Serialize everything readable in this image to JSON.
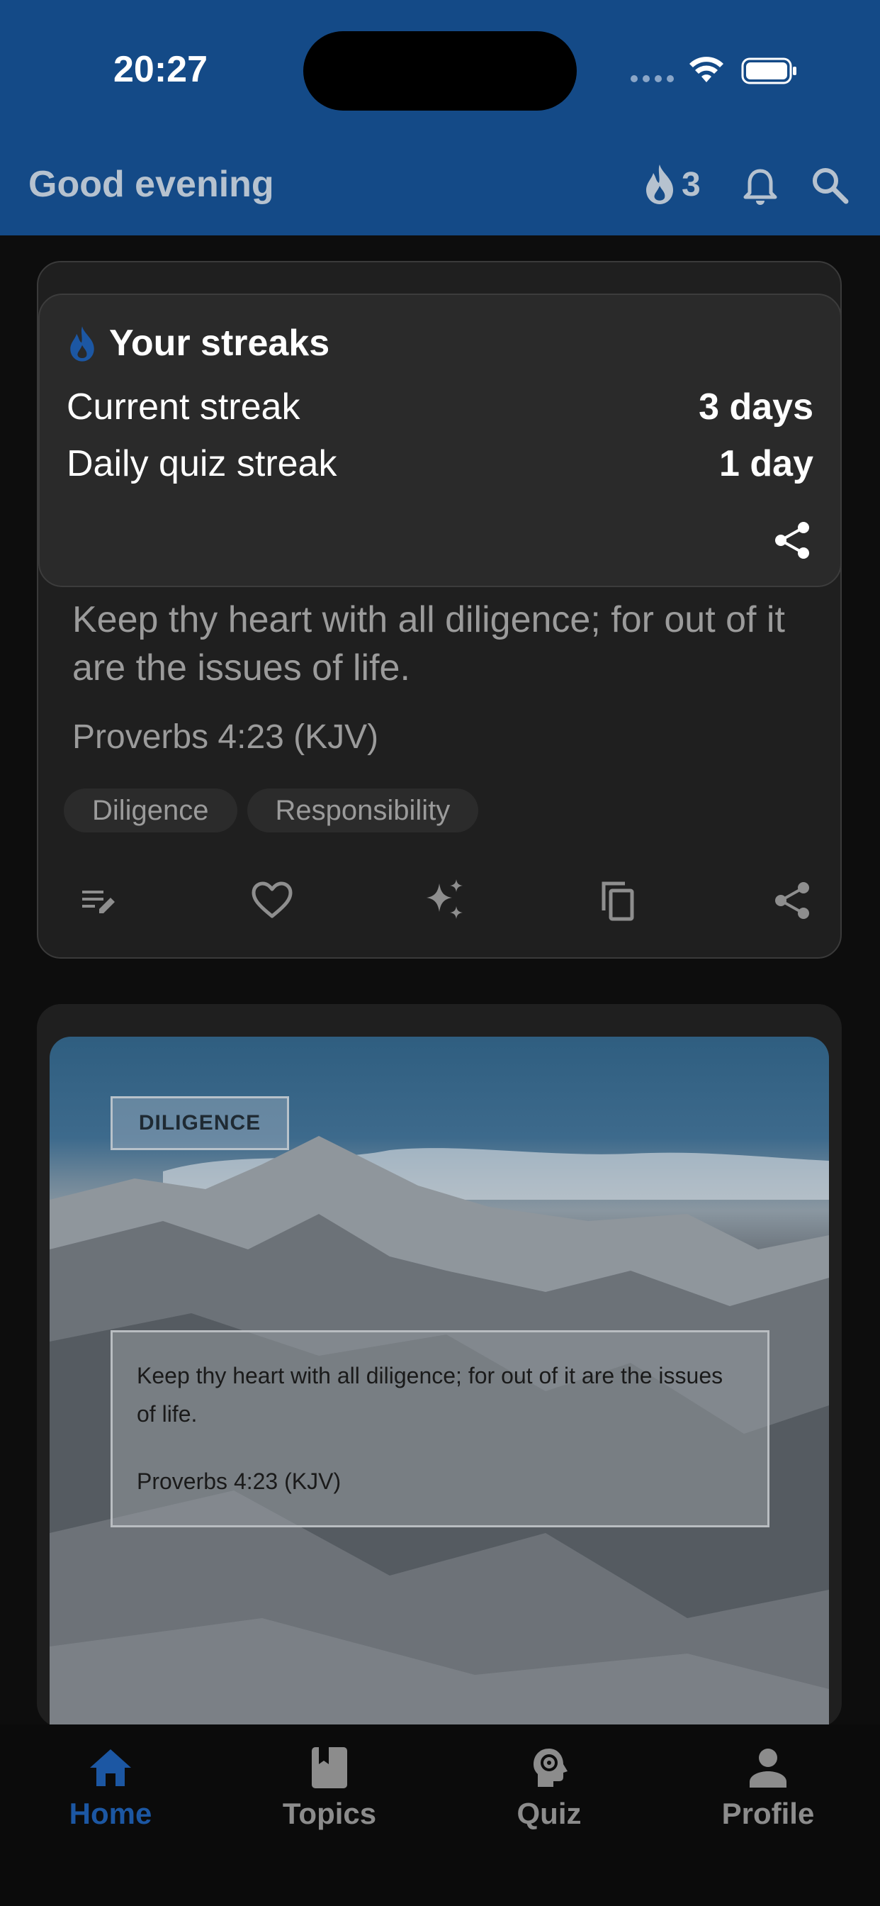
{
  "status": {
    "time": "20:27"
  },
  "header": {
    "greeting": "Good evening",
    "streak_count": "3"
  },
  "streaks_popup": {
    "title": "Your streaks",
    "rows": [
      {
        "label": "Current streak",
        "value": "3 days"
      },
      {
        "label": "Daily quiz streak",
        "value": "1 day"
      }
    ]
  },
  "verse_card": {
    "text": "Keep thy heart with all diligence; for out of it are the issues of life.",
    "reference": "Proverbs 4:23 (KJV)",
    "tags": [
      "Diligence",
      "Responsibility"
    ],
    "actions": [
      "edit-note-icon",
      "heart-icon",
      "sparkles-icon",
      "copy-icon",
      "share-icon"
    ]
  },
  "image_card": {
    "label": "DILIGENCE",
    "text": "Keep thy heart with all diligence; for out of it are the issues of life.",
    "reference": "Proverbs 4:23 (KJV)"
  },
  "nav": {
    "active": "Home",
    "items": [
      {
        "label": "Home",
        "icon": "home-icon"
      },
      {
        "label": "Topics",
        "icon": "book-icon"
      },
      {
        "label": "Quiz",
        "icon": "brain-gear-icon"
      },
      {
        "label": "Profile",
        "icon": "person-icon"
      }
    ]
  },
  "colors": {
    "header_bg": "#144a87",
    "accent": "#1c57a3",
    "background": "#0d0d0d",
    "card": "#1f1f1f",
    "popup": "#2a2a2a"
  }
}
